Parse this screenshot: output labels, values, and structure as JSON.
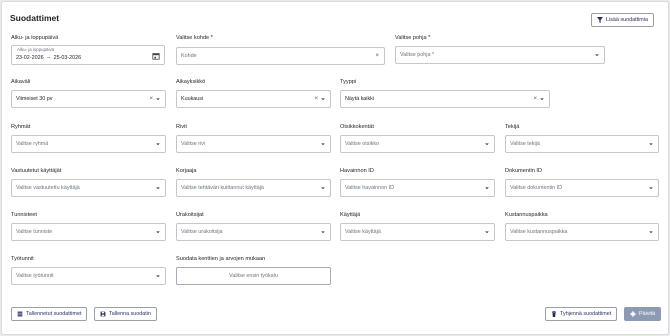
{
  "title": "Suodattimet",
  "add_filters_button": "Lisää suodattimia",
  "date_range": {
    "label": "Alku- ja loppupäivä",
    "float_label": "Alku- ja loppupäivä",
    "start": "23-02-2026",
    "separator": "–",
    "end": "25-03-2026"
  },
  "target": {
    "label": "Valitse kohde *",
    "placeholder": "Kohde"
  },
  "template": {
    "label": "Valitse pohja *",
    "placeholder": "Valitse pohja *"
  },
  "period": {
    "label": "Aikaväli",
    "value": "Viimeiset 30 pv"
  },
  "time_unit": {
    "label": "Aikayksikkö",
    "value": "Kuukausi"
  },
  "type": {
    "label": "Tyyppi",
    "value": "Näytä kaikki"
  },
  "row3": [
    {
      "label": "Ryhmät",
      "placeholder": "Valitse ryhmä"
    },
    {
      "label": "Rivit",
      "placeholder": "Valitse rivi"
    },
    {
      "label": "Otsikkokentät",
      "placeholder": "Valitse otsikko"
    },
    {
      "label": "Tekijä",
      "placeholder": "Valitse tekijä"
    }
  ],
  "row4": [
    {
      "label": "Vastuutetut käyttäjät",
      "placeholder": "Valitse vastuutettu käyttäjä"
    },
    {
      "label": "Korjaaja",
      "placeholder": "Valitse tehtävän kuittannut käyttäjä"
    },
    {
      "label": "Havainnon ID",
      "placeholder": "Valitse havainnon ID"
    },
    {
      "label": "Dokumentin ID",
      "placeholder": "Valitse dokumentin ID"
    }
  ],
  "row5": [
    {
      "label": "Tunnisteet",
      "placeholder": "Valitse tunniste"
    },
    {
      "label": "Urakoitsijat",
      "placeholder": "Valitse urakoitsija"
    },
    {
      "label": "Käyttäjä",
      "placeholder": "Valitse käyttäjä"
    },
    {
      "label": "Kustannuspaikka",
      "placeholder": "Valitse kustannuspaikka"
    }
  ],
  "work_hours": {
    "label": "Työtunnit",
    "placeholder": "Valitse työtunnit"
  },
  "field_filter": {
    "label": "Suodata kenttien ja arvojen mukaan",
    "placeholder": "Valitse ensin työkalu"
  },
  "saved_filters_button": "Tallennetut suodattimet",
  "save_filter_button": "Tallenna suodatin",
  "clear_filters_button": "Tyhjennä suodattimet",
  "update_button": "Päivitä",
  "colors": {
    "primary_text": "#1f2d5a",
    "disabled_primary": "#8c9bb3",
    "border": "#c4c7cc"
  }
}
